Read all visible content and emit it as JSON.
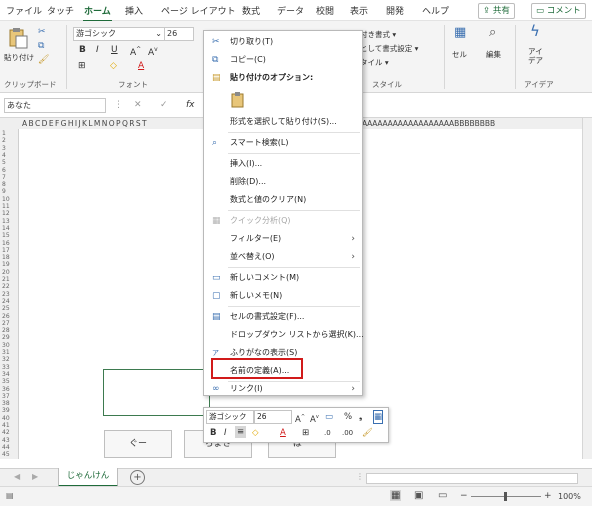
{
  "menubar": {
    "tabs": [
      "ファイル",
      "タッチ",
      "ホーム",
      "挿入",
      "ページ レイアウト",
      "数式",
      "データ",
      "校閲",
      "表示",
      "開発",
      "ヘルプ"
    ],
    "active_tab": "ホーム",
    "share_label": "共有",
    "comment_label": "コメント"
  },
  "ribbon": {
    "paste_label": "貼り付け",
    "font_name": "游ゴシック",
    "font_size": "26",
    "clipboard_group": "クリップボード",
    "font_group": "フォント",
    "style_group": "スタイル",
    "idea_group": "アイデア",
    "cond_format": "条件付き書式 ▾",
    "table_format": "ブルとして書式設定 ▾",
    "cell_style": "のスタイル ▾",
    "cell_label": "セル",
    "edit_label": "編集",
    "idea_label": "アイ\nデア"
  },
  "formula_bar": {
    "name_box": "あなた",
    "fx": "fx"
  },
  "grid": {
    "col_headers_left": "A B C D E F G H I J K L M N O P Q R S T",
    "col_headers_right": "A A A A A A A A A A A A A A A A A A B B B B B B B B",
    "row_numbers": [
      "1",
      "2",
      "3",
      "4",
      "5",
      "6",
      "7",
      "8",
      "9",
      "10",
      "11",
      "12",
      "13",
      "14",
      "15",
      "16",
      "17",
      "18",
      "19",
      "20",
      "21",
      "22",
      "23",
      "24",
      "25",
      "26",
      "27",
      "28",
      "29",
      "30",
      "31",
      "32",
      "33",
      "34",
      "35",
      "36",
      "37",
      "38",
      "39",
      "40",
      "41",
      "42",
      "43",
      "44",
      "45"
    ]
  },
  "shapes": {
    "button_left": "ぐー",
    "button_middle": "ちょき",
    "button_right": "ぱー"
  },
  "context_menu": {
    "items": [
      {
        "label": "切り取り(T)",
        "icon": "scissors-icon"
      },
      {
        "label": "コピー(C)",
        "icon": "copy-icon"
      },
      {
        "label": "貼り付けのオプション:",
        "icon": "paste-options-icon"
      },
      {
        "label": "形式を選択して貼り付け(S)..."
      },
      {
        "label": "スマート検索(L)",
        "icon": "search-icon"
      },
      {
        "label": "挿入(I)..."
      },
      {
        "label": "削除(D)..."
      },
      {
        "label": "数式と値のクリア(N)"
      },
      {
        "label": "クイック分析(Q)",
        "icon": "quick-analysis-icon"
      },
      {
        "label": "フィルター(E)"
      },
      {
        "label": "並べ替え(O)"
      },
      {
        "label": "新しいコメント(M)",
        "icon": "comment-icon"
      },
      {
        "label": "新しいメモ(N)",
        "icon": "note-icon"
      },
      {
        "label": "セルの書式設定(F)...",
        "icon": "format-cells-icon"
      },
      {
        "label": "ドロップダウン リストから選択(K)..."
      },
      {
        "label": "ふりがなの表示(S)",
        "icon": "furigana-icon"
      },
      {
        "label": "名前の定義(A)..."
      },
      {
        "label": "リンク(I)",
        "icon": "link-icon"
      }
    ]
  },
  "mini_toolbar": {
    "font_name": "游ゴシック",
    "font_size": "26",
    "percent": "%",
    "bold": "B",
    "italic": "I"
  },
  "sheet_tabs": {
    "active": "じゃんけん"
  },
  "status": {
    "zoom": "100%"
  },
  "colors": {
    "accent": "#1f6b3a",
    "highlight": "#d11a1a"
  }
}
